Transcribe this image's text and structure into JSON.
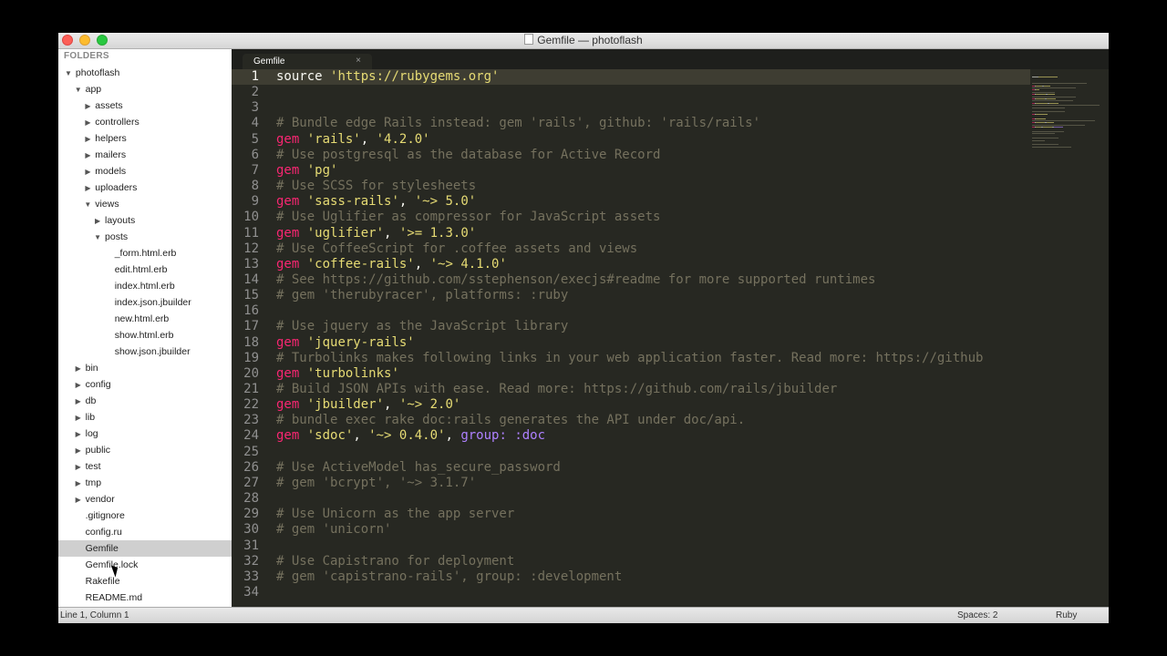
{
  "window": {
    "title": "Gemfile — photoflash"
  },
  "sidebar": {
    "header": "FOLDERS",
    "items": [
      {
        "label": "photoflash",
        "depth": 0,
        "kind": "folder-open"
      },
      {
        "label": "app",
        "depth": 1,
        "kind": "folder-open"
      },
      {
        "label": "assets",
        "depth": 2,
        "kind": "folder-closed"
      },
      {
        "label": "controllers",
        "depth": 2,
        "kind": "folder-closed"
      },
      {
        "label": "helpers",
        "depth": 2,
        "kind": "folder-closed"
      },
      {
        "label": "mailers",
        "depth": 2,
        "kind": "folder-closed"
      },
      {
        "label": "models",
        "depth": 2,
        "kind": "folder-closed"
      },
      {
        "label": "uploaders",
        "depth": 2,
        "kind": "folder-closed"
      },
      {
        "label": "views",
        "depth": 2,
        "kind": "folder-open"
      },
      {
        "label": "layouts",
        "depth": 3,
        "kind": "folder-closed"
      },
      {
        "label": "posts",
        "depth": 3,
        "kind": "folder-open"
      },
      {
        "label": "_form.html.erb",
        "depth": 4,
        "kind": "file"
      },
      {
        "label": "edit.html.erb",
        "depth": 4,
        "kind": "file"
      },
      {
        "label": "index.html.erb",
        "depth": 4,
        "kind": "file"
      },
      {
        "label": "index.json.jbuilder",
        "depth": 4,
        "kind": "file"
      },
      {
        "label": "new.html.erb",
        "depth": 4,
        "kind": "file"
      },
      {
        "label": "show.html.erb",
        "depth": 4,
        "kind": "file"
      },
      {
        "label": "show.json.jbuilder",
        "depth": 4,
        "kind": "file"
      },
      {
        "label": "bin",
        "depth": 1,
        "kind": "folder-closed"
      },
      {
        "label": "config",
        "depth": 1,
        "kind": "folder-closed"
      },
      {
        "label": "db",
        "depth": 1,
        "kind": "folder-closed"
      },
      {
        "label": "lib",
        "depth": 1,
        "kind": "folder-closed"
      },
      {
        "label": "log",
        "depth": 1,
        "kind": "folder-closed"
      },
      {
        "label": "public",
        "depth": 1,
        "kind": "folder-closed"
      },
      {
        "label": "test",
        "depth": 1,
        "kind": "folder-closed"
      },
      {
        "label": "tmp",
        "depth": 1,
        "kind": "folder-closed"
      },
      {
        "label": "vendor",
        "depth": 1,
        "kind": "folder-closed"
      },
      {
        "label": ".gitignore",
        "depth": 1,
        "kind": "file"
      },
      {
        "label": "config.ru",
        "depth": 1,
        "kind": "file"
      },
      {
        "label": "Gemfile",
        "depth": 1,
        "kind": "file",
        "selected": true
      },
      {
        "label": "Gemfile.lock",
        "depth": 1,
        "kind": "file"
      },
      {
        "label": "Rakefile",
        "depth": 1,
        "kind": "file"
      },
      {
        "label": "README.md",
        "depth": 1,
        "kind": "file"
      }
    ]
  },
  "tabs": [
    {
      "label": "Gemfile",
      "close": "×"
    }
  ],
  "editor": {
    "current_line": 1,
    "lines": [
      [
        [
          "t",
          "source "
        ],
        [
          "s",
          "'https://rubygems.org'"
        ]
      ],
      [],
      [],
      [
        [
          "c",
          "# Bundle edge Rails instead: gem 'rails', github: 'rails/rails'"
        ]
      ],
      [
        [
          "k",
          "gem"
        ],
        [
          "t",
          " "
        ],
        [
          "s",
          "'rails'"
        ],
        [
          "t",
          ", "
        ],
        [
          "s",
          "'4.2.0'"
        ]
      ],
      [
        [
          "c",
          "# Use postgresql as the database for Active Record"
        ]
      ],
      [
        [
          "k",
          "gem"
        ],
        [
          "t",
          " "
        ],
        [
          "s",
          "'pg'"
        ]
      ],
      [
        [
          "c",
          "# Use SCSS for stylesheets"
        ]
      ],
      [
        [
          "k",
          "gem"
        ],
        [
          "t",
          " "
        ],
        [
          "s",
          "'sass-rails'"
        ],
        [
          "t",
          ", "
        ],
        [
          "s",
          "'~> 5.0'"
        ]
      ],
      [
        [
          "c",
          "# Use Uglifier as compressor for JavaScript assets"
        ]
      ],
      [
        [
          "k",
          "gem"
        ],
        [
          "t",
          " "
        ],
        [
          "s",
          "'uglifier'"
        ],
        [
          "t",
          ", "
        ],
        [
          "s",
          "'>= 1.3.0'"
        ]
      ],
      [
        [
          "c",
          "# Use CoffeeScript for .coffee assets and views"
        ]
      ],
      [
        [
          "k",
          "gem"
        ],
        [
          "t",
          " "
        ],
        [
          "s",
          "'coffee-rails'"
        ],
        [
          "t",
          ", "
        ],
        [
          "s",
          "'~> 4.1.0'"
        ]
      ],
      [
        [
          "c",
          "# See https://github.com/sstephenson/execjs#readme for more supported runtimes"
        ]
      ],
      [
        [
          "c",
          "# gem 'therubyracer', platforms: :ruby"
        ]
      ],
      [],
      [
        [
          "c",
          "# Use jquery as the JavaScript library"
        ]
      ],
      [
        [
          "k",
          "gem"
        ],
        [
          "t",
          " "
        ],
        [
          "s",
          "'jquery-rails'"
        ]
      ],
      [
        [
          "c",
          "# Turbolinks makes following links in your web application faster. Read more: https://github"
        ]
      ],
      [
        [
          "k",
          "gem"
        ],
        [
          "t",
          " "
        ],
        [
          "s",
          "'turbolinks'"
        ]
      ],
      [
        [
          "c",
          "# Build JSON APIs with ease. Read more: https://github.com/rails/jbuilder"
        ]
      ],
      [
        [
          "k",
          "gem"
        ],
        [
          "t",
          " "
        ],
        [
          "s",
          "'jbuilder'"
        ],
        [
          "t",
          ", "
        ],
        [
          "s",
          "'~> 2.0'"
        ]
      ],
      [
        [
          "c",
          "# bundle exec rake doc:rails generates the API under doc/api."
        ]
      ],
      [
        [
          "k",
          "gem"
        ],
        [
          "t",
          " "
        ],
        [
          "s",
          "'sdoc'"
        ],
        [
          "t",
          ", "
        ],
        [
          "s",
          "'~> 0.4.0'"
        ],
        [
          "t",
          ", "
        ],
        [
          "sym",
          "group: :doc"
        ]
      ],
      [],
      [
        [
          "c",
          "# Use ActiveModel has_secure_password"
        ]
      ],
      [
        [
          "c",
          "# gem 'bcrypt', '~> 3.1.7'"
        ]
      ],
      [],
      [
        [
          "c",
          "# Use Unicorn as the app server"
        ]
      ],
      [
        [
          "c",
          "# gem 'unicorn'"
        ]
      ],
      [],
      [
        [
          "c",
          "# Use Capistrano for deployment"
        ]
      ],
      [
        [
          "c",
          "# gem 'capistrano-rails', group: :development"
        ]
      ],
      []
    ]
  },
  "status": {
    "position": "Line 1, Column 1",
    "spaces": "Spaces: 2",
    "syntax": "Ruby"
  },
  "colors": {
    "comment": "#75715e",
    "string": "#e6db74",
    "keyword": "#f92672",
    "symbol": "#ae81ff",
    "background": "#272822"
  },
  "icons": {
    "folder_open": "triangle-down-icon",
    "folder_closed": "triangle-right-icon",
    "file": "document-icon",
    "close": "close-icon"
  }
}
